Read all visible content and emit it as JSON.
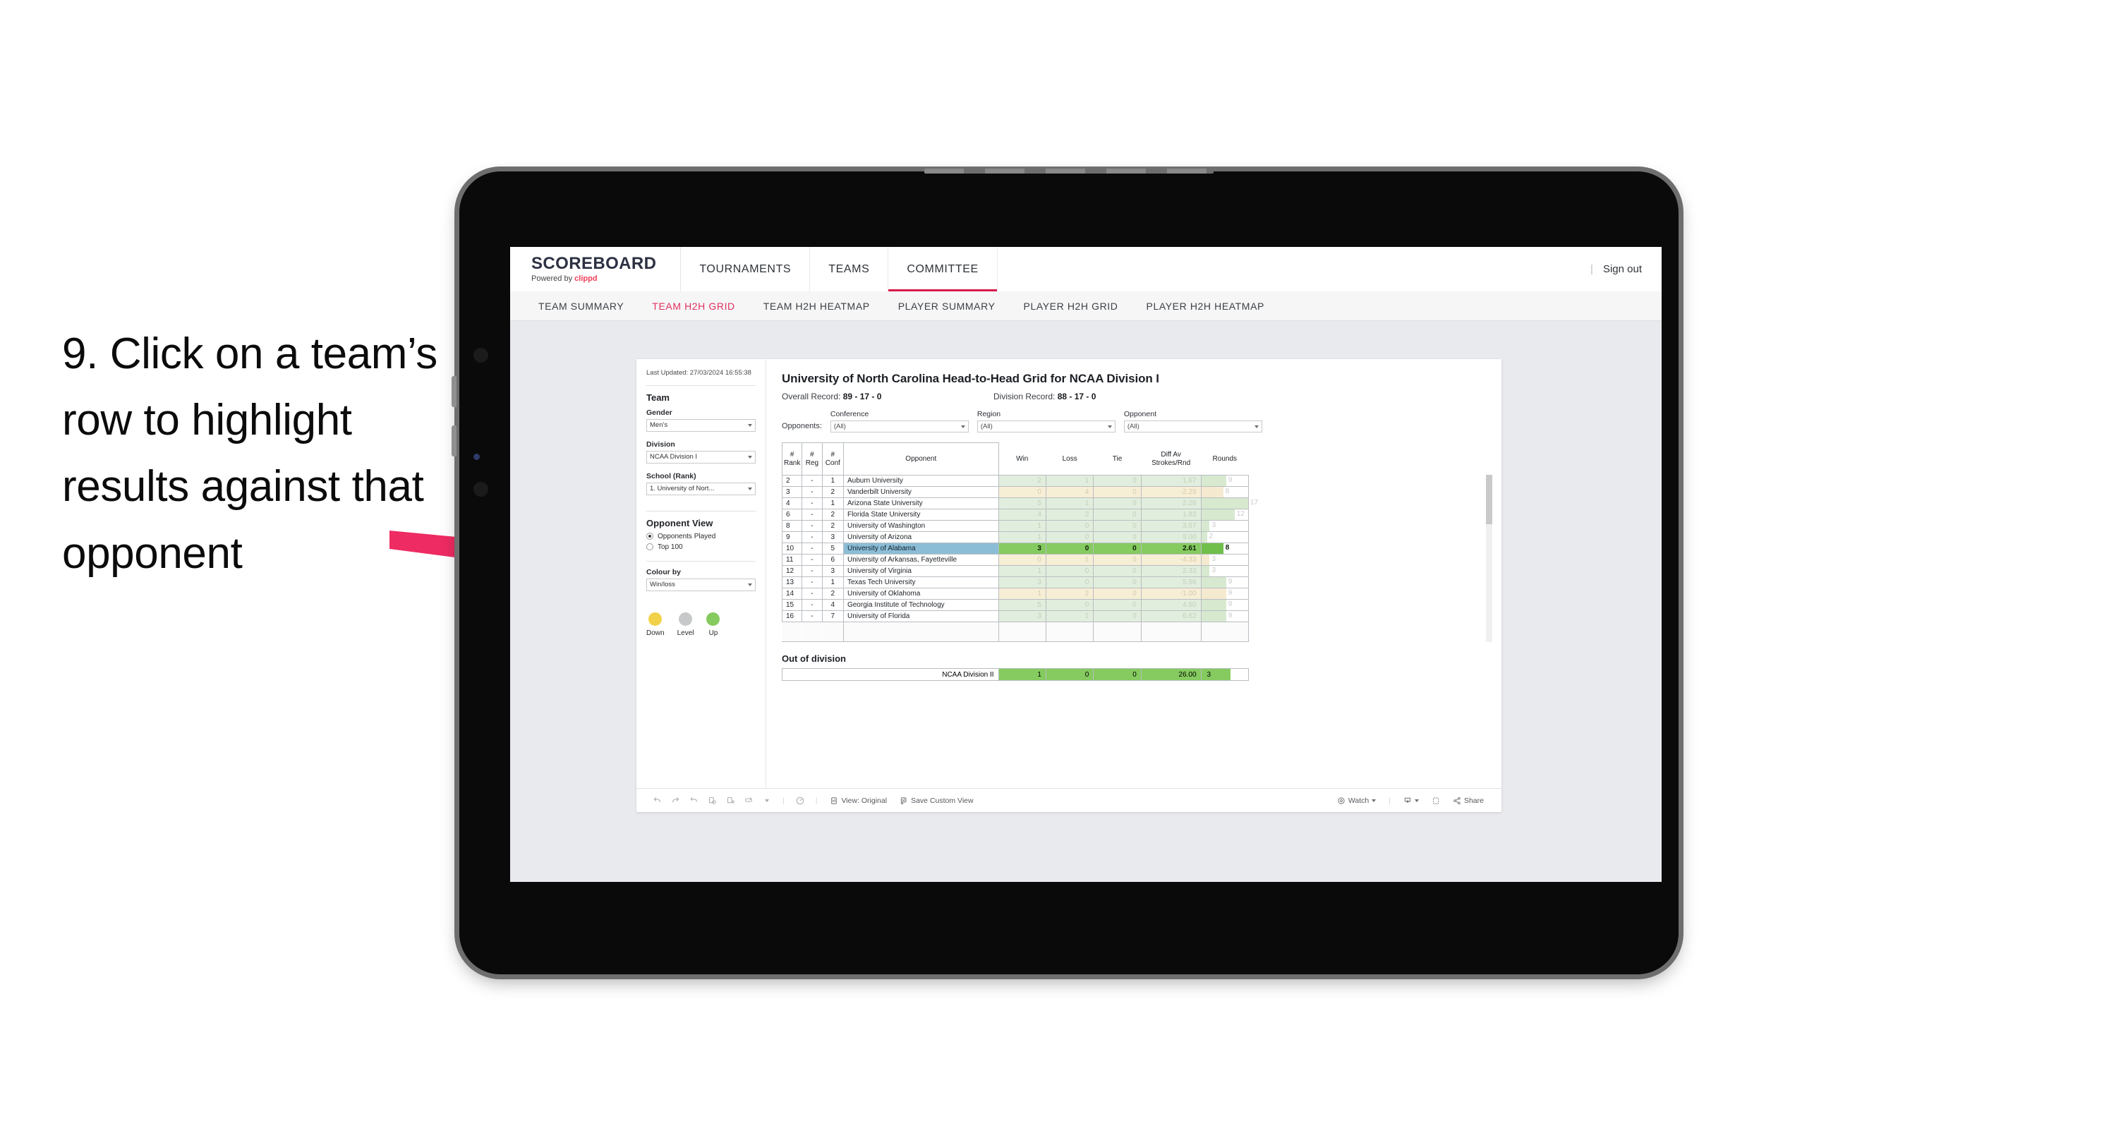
{
  "annotation": {
    "text": "9. Click on a team’s row to highlight results against that opponent",
    "arrow_color": "#ee2b63"
  },
  "app": {
    "brand": {
      "name": "SCOREBOARD",
      "powered_prefix": "Powered by ",
      "powered_name": "clippd"
    },
    "top_nav": [
      {
        "label": "TOURNAMENTS",
        "active": false
      },
      {
        "label": "TEAMS",
        "active": false
      },
      {
        "label": "COMMITTEE",
        "active": true
      }
    ],
    "sign_out": "Sign out",
    "sub_nav": [
      {
        "label": "TEAM SUMMARY",
        "active": false
      },
      {
        "label": "TEAM H2H GRID",
        "active": true
      },
      {
        "label": "TEAM H2H HEATMAP",
        "active": false
      },
      {
        "label": "PLAYER SUMMARY",
        "active": false
      },
      {
        "label": "PLAYER H2H GRID",
        "active": false
      },
      {
        "label": "PLAYER H2H HEATMAP",
        "active": false
      }
    ]
  },
  "sidebar": {
    "last_updated": "Last Updated: 27/03/2024 16:55:38",
    "team_heading": "Team",
    "gender": {
      "label": "Gender",
      "value": "Men’s"
    },
    "division": {
      "label": "Division",
      "value": "NCAA Division I"
    },
    "school": {
      "label": "School (Rank)",
      "value": "1. University of Nort..."
    },
    "opponent_view": {
      "heading": "Opponent View",
      "options": [
        {
          "label": "Opponents Played",
          "selected": true
        },
        {
          "label": "Top 100",
          "selected": false
        }
      ]
    },
    "colour_by": {
      "label": "Colour by",
      "value": "Win/loss"
    },
    "legend": [
      {
        "label": "Down",
        "color": "#f2d14a"
      },
      {
        "label": "Level",
        "color": "#c6c8ca"
      },
      {
        "label": "Up",
        "color": "#85cb5f"
      }
    ]
  },
  "main": {
    "title": "University of North Carolina Head-to-Head Grid for NCAA Division I",
    "overall_record_label": "Overall Record: ",
    "overall_record_value": "89 - 17 - 0",
    "division_record_label": "Division Record: ",
    "division_record_value": "88 - 17 - 0",
    "opponents_label": "Opponents:",
    "filters": [
      {
        "label": "Conference",
        "value": "(All)"
      },
      {
        "label": "Region",
        "value": "(All)"
      },
      {
        "label": "Opponent",
        "value": "(All)"
      }
    ],
    "table": {
      "headers": [
        "#\nRank",
        "#\nReg",
        "#\nConf",
        "Opponent",
        "Win",
        "Loss",
        "Tie",
        "Diff Av\nStrokes/Rnd",
        "Rounds"
      ],
      "rows": [
        {
          "rank": "2",
          "reg": "-",
          "conf": "1",
          "opponent": "Auburn University",
          "win": "2",
          "loss": "1",
          "tie": "0",
          "diff": "1.67",
          "rounds": "9",
          "state": "up",
          "bar_pct": 53
        },
        {
          "rank": "3",
          "reg": "-",
          "conf": "2",
          "opponent": "Vanderbilt University",
          "win": "0",
          "loss": "4",
          "tie": "0",
          "diff": "-2.29",
          "rounds": "8",
          "state": "down",
          "bar_pct": 47
        },
        {
          "rank": "4",
          "reg": "-",
          "conf": "1",
          "opponent": "Arizona State University",
          "win": "5",
          "loss": "1",
          "tie": "0",
          "diff": "2.28",
          "rounds": "17",
          "state": "up",
          "bar_pct": 100
        },
        {
          "rank": "6",
          "reg": "-",
          "conf": "2",
          "opponent": "Florida State University",
          "win": "4",
          "loss": "2",
          "tie": "0",
          "diff": "1.83",
          "rounds": "12",
          "state": "up",
          "bar_pct": 71
        },
        {
          "rank": "8",
          "reg": "-",
          "conf": "2",
          "opponent": "University of Washington",
          "win": "1",
          "loss": "0",
          "tie": "0",
          "diff": "3.67",
          "rounds": "3",
          "state": "up",
          "bar_pct": 18
        },
        {
          "rank": "9",
          "reg": "-",
          "conf": "3",
          "opponent": "University of Arizona",
          "win": "1",
          "loss": "0",
          "tie": "0",
          "diff": "9.00",
          "rounds": "2",
          "state": "up",
          "bar_pct": 12
        },
        {
          "rank": "10",
          "reg": "-",
          "conf": "5",
          "opponent": "University of Alabama",
          "win": "3",
          "loss": "0",
          "tie": "0",
          "diff": "2.61",
          "rounds": "8",
          "state": "selected",
          "bar_pct": 47
        },
        {
          "rank": "11",
          "reg": "-",
          "conf": "6",
          "opponent": "University of Arkansas, Fayetteville",
          "win": "0",
          "loss": "1",
          "tie": "0",
          "diff": "-4.33",
          "rounds": "3",
          "state": "down",
          "bar_pct": 18
        },
        {
          "rank": "12",
          "reg": "-",
          "conf": "3",
          "opponent": "University of Virginia",
          "win": "1",
          "loss": "0",
          "tie": "0",
          "diff": "2.33",
          "rounds": "3",
          "state": "up",
          "bar_pct": 18
        },
        {
          "rank": "13",
          "reg": "-",
          "conf": "1",
          "opponent": "Texas Tech University",
          "win": "3",
          "loss": "0",
          "tie": "0",
          "diff": "5.56",
          "rounds": "9",
          "state": "up",
          "bar_pct": 53
        },
        {
          "rank": "14",
          "reg": "-",
          "conf": "2",
          "opponent": "University of Oklahoma",
          "win": "1",
          "loss": "2",
          "tie": "0",
          "diff": "-1.00",
          "rounds": "9",
          "state": "down",
          "bar_pct": 53
        },
        {
          "rank": "15",
          "reg": "-",
          "conf": "4",
          "opponent": "Georgia Institute of Technology",
          "win": "5",
          "loss": "0",
          "tie": "0",
          "diff": "4.50",
          "rounds": "9",
          "state": "up",
          "bar_pct": 53
        },
        {
          "rank": "16",
          "reg": "-",
          "conf": "7",
          "opponent": "University of Florida",
          "win": "3",
          "loss": "1",
          "tie": "0",
          "diff": "6.62",
          "rounds": "9",
          "state": "up",
          "bar_pct": 53
        }
      ]
    },
    "out_of_division": {
      "heading": "Out of division",
      "row": {
        "label": "NCAA Division II",
        "win": "1",
        "loss": "0",
        "tie": "0",
        "diff": "26.00",
        "rounds": "3"
      }
    }
  },
  "toolbar": {
    "icons": [
      "undo-icon",
      "redo-icon",
      "revert-icon",
      "refresh-data-icon",
      "pause-icon",
      "loop-icon",
      "chevron-down-icon"
    ],
    "highlight_icon": "highlight-icon",
    "view_label": "View: Original",
    "save_label": "Save Custom View",
    "watch_label": "Watch",
    "download_label": "download-icon",
    "fullscreen_label": "fullscreen-icon",
    "share_label": "Share"
  },
  "colors": {
    "accent": "#d81b4a",
    "sub_accent": "#e0315c",
    "up_fill": "#e2eedd",
    "down_fill": "#f7eed6",
    "selected_fill": "#85cb5f",
    "selected_name_fill": "#8cbdd6",
    "bar_up": "#d7e9cf",
    "bar_down": "#f5ead0",
    "bar_selected": "#6fbf4a"
  }
}
